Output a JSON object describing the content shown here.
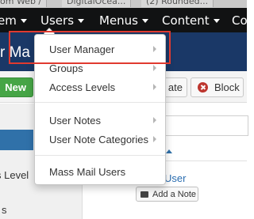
{
  "browser": {
    "tabs": [
      "om Web /",
      "DigitalOcea...",
      "(2) Rounded..."
    ]
  },
  "navbar": {
    "items": [
      "em",
      "Users",
      "Menus",
      "Content",
      "Co"
    ]
  },
  "page": {
    "title": "r Ma"
  },
  "toolbar": {
    "new_label": "New",
    "activate_label": "ate",
    "block_label": "Block"
  },
  "sidebar": {
    "items": [
      "s Level",
      "s"
    ]
  },
  "table": {
    "user_link": "User",
    "add_note_label": "Add a Note"
  },
  "users_menu": {
    "items": [
      {
        "label": "User Manager"
      },
      {
        "label": "Groups"
      },
      {
        "label": "Access Levels"
      },
      {
        "label": "User Notes"
      },
      {
        "label": "User Note Categories"
      },
      {
        "label": "Mass Mail Users"
      }
    ]
  },
  "colors": {
    "navbar_bg": "#111213",
    "title_bg": "#1a3867",
    "new_button": "#46a546",
    "block_icon": "#bd362f",
    "link": "#2a6db0",
    "highlight": "#e03a2f"
  }
}
